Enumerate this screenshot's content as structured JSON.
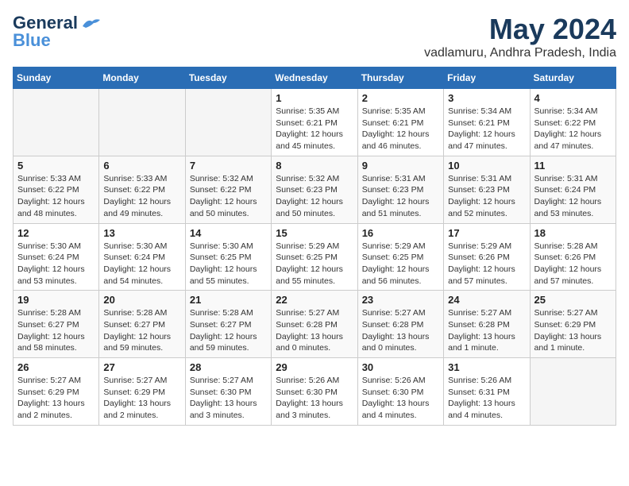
{
  "logo": {
    "line1": "General",
    "line2": "Blue"
  },
  "title": "May 2024",
  "subtitle": "vadlamuru, Andhra Pradesh, India",
  "days_of_week": [
    "Sunday",
    "Monday",
    "Tuesday",
    "Wednesday",
    "Thursday",
    "Friday",
    "Saturday"
  ],
  "weeks": [
    [
      {
        "day": "",
        "empty": true
      },
      {
        "day": "",
        "empty": true
      },
      {
        "day": "",
        "empty": true
      },
      {
        "day": "1",
        "sunrise": "5:35 AM",
        "sunset": "6:21 PM",
        "daylight": "12 hours and 45 minutes."
      },
      {
        "day": "2",
        "sunrise": "5:35 AM",
        "sunset": "6:21 PM",
        "daylight": "12 hours and 46 minutes."
      },
      {
        "day": "3",
        "sunrise": "5:34 AM",
        "sunset": "6:21 PM",
        "daylight": "12 hours and 47 minutes."
      },
      {
        "day": "4",
        "sunrise": "5:34 AM",
        "sunset": "6:22 PM",
        "daylight": "12 hours and 47 minutes."
      }
    ],
    [
      {
        "day": "5",
        "sunrise": "5:33 AM",
        "sunset": "6:22 PM",
        "daylight": "12 hours and 48 minutes."
      },
      {
        "day": "6",
        "sunrise": "5:33 AM",
        "sunset": "6:22 PM",
        "daylight": "12 hours and 49 minutes."
      },
      {
        "day": "7",
        "sunrise": "5:32 AM",
        "sunset": "6:22 PM",
        "daylight": "12 hours and 50 minutes."
      },
      {
        "day": "8",
        "sunrise": "5:32 AM",
        "sunset": "6:23 PM",
        "daylight": "12 hours and 50 minutes."
      },
      {
        "day": "9",
        "sunrise": "5:31 AM",
        "sunset": "6:23 PM",
        "daylight": "12 hours and 51 minutes."
      },
      {
        "day": "10",
        "sunrise": "5:31 AM",
        "sunset": "6:23 PM",
        "daylight": "12 hours and 52 minutes."
      },
      {
        "day": "11",
        "sunrise": "5:31 AM",
        "sunset": "6:24 PM",
        "daylight": "12 hours and 53 minutes."
      }
    ],
    [
      {
        "day": "12",
        "sunrise": "5:30 AM",
        "sunset": "6:24 PM",
        "daylight": "12 hours and 53 minutes."
      },
      {
        "day": "13",
        "sunrise": "5:30 AM",
        "sunset": "6:24 PM",
        "daylight": "12 hours and 54 minutes."
      },
      {
        "day": "14",
        "sunrise": "5:30 AM",
        "sunset": "6:25 PM",
        "daylight": "12 hours and 55 minutes."
      },
      {
        "day": "15",
        "sunrise": "5:29 AM",
        "sunset": "6:25 PM",
        "daylight": "12 hours and 55 minutes."
      },
      {
        "day": "16",
        "sunrise": "5:29 AM",
        "sunset": "6:25 PM",
        "daylight": "12 hours and 56 minutes."
      },
      {
        "day": "17",
        "sunrise": "5:29 AM",
        "sunset": "6:26 PM",
        "daylight": "12 hours and 57 minutes."
      },
      {
        "day": "18",
        "sunrise": "5:28 AM",
        "sunset": "6:26 PM",
        "daylight": "12 hours and 57 minutes."
      }
    ],
    [
      {
        "day": "19",
        "sunrise": "5:28 AM",
        "sunset": "6:27 PM",
        "daylight": "12 hours and 58 minutes."
      },
      {
        "day": "20",
        "sunrise": "5:28 AM",
        "sunset": "6:27 PM",
        "daylight": "12 hours and 59 minutes."
      },
      {
        "day": "21",
        "sunrise": "5:28 AM",
        "sunset": "6:27 PM",
        "daylight": "12 hours and 59 minutes."
      },
      {
        "day": "22",
        "sunrise": "5:27 AM",
        "sunset": "6:28 PM",
        "daylight": "13 hours and 0 minutes."
      },
      {
        "day": "23",
        "sunrise": "5:27 AM",
        "sunset": "6:28 PM",
        "daylight": "13 hours and 0 minutes."
      },
      {
        "day": "24",
        "sunrise": "5:27 AM",
        "sunset": "6:28 PM",
        "daylight": "13 hours and 1 minute."
      },
      {
        "day": "25",
        "sunrise": "5:27 AM",
        "sunset": "6:29 PM",
        "daylight": "13 hours and 1 minute."
      }
    ],
    [
      {
        "day": "26",
        "sunrise": "5:27 AM",
        "sunset": "6:29 PM",
        "daylight": "13 hours and 2 minutes."
      },
      {
        "day": "27",
        "sunrise": "5:27 AM",
        "sunset": "6:29 PM",
        "daylight": "13 hours and 2 minutes."
      },
      {
        "day": "28",
        "sunrise": "5:27 AM",
        "sunset": "6:30 PM",
        "daylight": "13 hours and 3 minutes."
      },
      {
        "day": "29",
        "sunrise": "5:26 AM",
        "sunset": "6:30 PM",
        "daylight": "13 hours and 3 minutes."
      },
      {
        "day": "30",
        "sunrise": "5:26 AM",
        "sunset": "6:30 PM",
        "daylight": "13 hours and 4 minutes."
      },
      {
        "day": "31",
        "sunrise": "5:26 AM",
        "sunset": "6:31 PM",
        "daylight": "13 hours and 4 minutes."
      },
      {
        "day": "",
        "empty": true
      }
    ]
  ]
}
